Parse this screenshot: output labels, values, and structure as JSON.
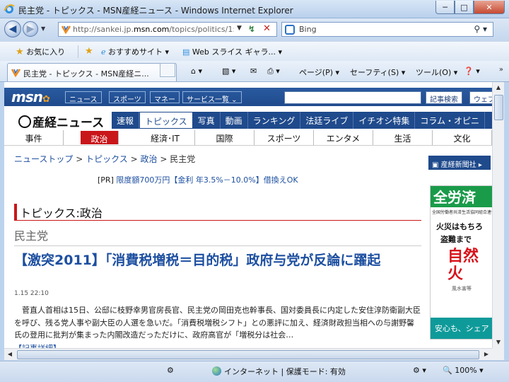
{
  "window": {
    "title": "民主党 - トピックス - MSN産経ニュース - Windows Internet Explorer",
    "minimize": "─",
    "maximize": "□",
    "close": "✕"
  },
  "address": {
    "url_prefix": "http://sankei.jp.",
    "url_domain": "msn.com",
    "url_path": "/topics/politics/1:",
    "search_label": "Bing",
    "back_glyph": "◀",
    "fwd_glyph": "▶"
  },
  "favorites_bar": {
    "favorites_label": "お気に入り",
    "suggested_sites": "おすすめサイト ▾",
    "web_slice": "Web スライス ギャラ... ▾"
  },
  "tab": {
    "title": "民主党 - トピックス - MSN産経ニ..."
  },
  "command_bar": {
    "page": "ページ(P) ▾",
    "safety": "セーフティ(S) ▾",
    "tools": "ツール(O) ▾",
    "help": "❓ ▾",
    "chevron": "»"
  },
  "msn": {
    "logo": "msn",
    "buttons": [
      "ニュース",
      "スポーツ",
      "マネー",
      "サービス一覧 ⌄"
    ],
    "search_button": "記事検索",
    "web_button": "ウェブ"
  },
  "sankei": {
    "logo": "産経ニュース",
    "nav": [
      "速報",
      "トピックス",
      "写真",
      "動画",
      "ランキング",
      "法廷ライブ",
      "イチオシ特集",
      "コラム・オピニ"
    ],
    "active_nav": "トピックス"
  },
  "subnav": [
    "事件",
    "政治",
    "経済･IT",
    "国際",
    "スポーツ",
    "エンタメ",
    "生活",
    "文化"
  ],
  "breadcrumb": {
    "items": [
      "ニューストップ",
      "トピックス",
      "政治"
    ],
    "current": "民主党",
    "sep": ">"
  },
  "pr": {
    "label": "[PR]",
    "text": "限度額700万円【金利 年3.5%－10.0%】借換えOK"
  },
  "sidebar": {
    "link": "産経新聞社"
  },
  "ad": {
    "top": "全労済",
    "sub": "全国労働者共済生活協同組合連合会",
    "line1": "火災はもちろ",
    "line2": "盗難まで",
    "red": "自然\n火",
    "small": "風水害等",
    "bottom": "安心も、シェア"
  },
  "article": {
    "section": "トピックス:政治",
    "category": "民主党",
    "headline": "【激突2011】「消費税増税＝目的税」政府与党が反論に躍起",
    "time": "1.15 22:10",
    "body": "菅直人首相は15日、公邸に枝野幸男官房長官、民主党の岡田克也幹事長、国対委員長に内定した安住淳防衛副大臣を呼び、残る党人事や副大臣の人選を急いだ。「消費税増税シフト」との悪評に加え、経済財政担当相への与謝野馨氏の登用に批判が集まった内閣改造だっただけに、政府高官が「増税分は社会…",
    "more": "【記事詳細】"
  },
  "statusbar": {
    "zone": "インターネット | 保護モード: 有効",
    "zoom": "100%"
  }
}
